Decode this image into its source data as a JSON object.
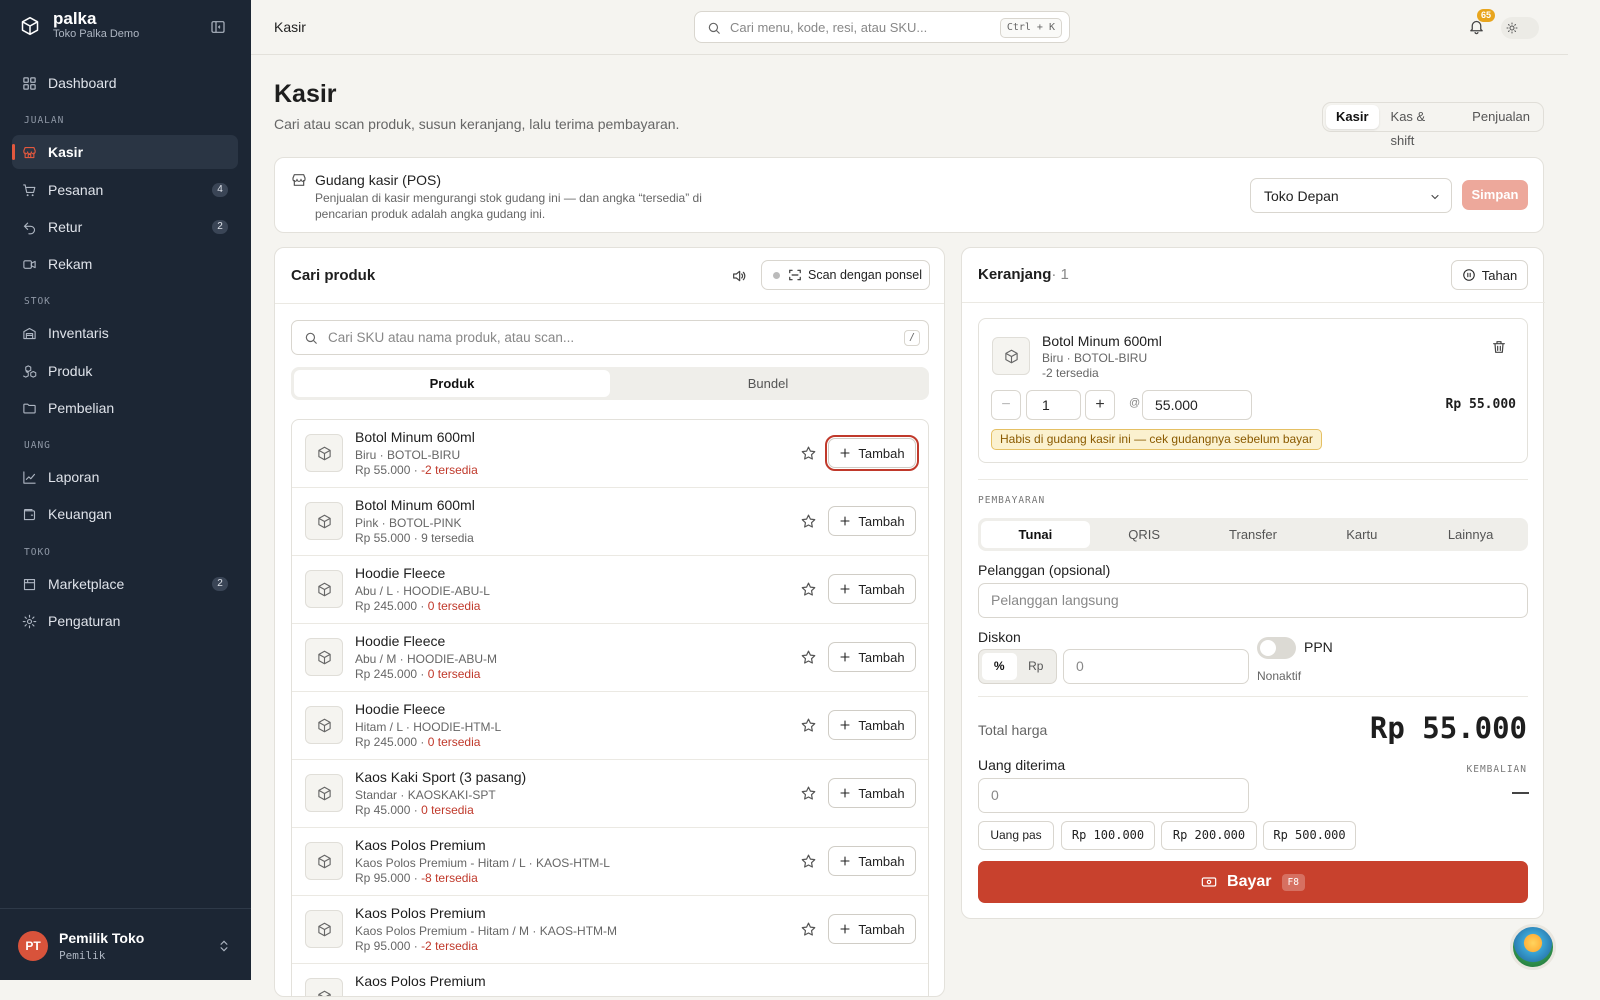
{
  "brand": {
    "name": "palka",
    "store": "Toko Palka Demo"
  },
  "nav": {
    "dashboard": "Dashboard",
    "sections": {
      "jualan": "JUALAN",
      "stok": "STOK",
      "uang": "UANG",
      "toko": "TOKO"
    },
    "items": [
      {
        "label": "Kasir"
      },
      {
        "label": "Pesanan",
        "badge": "4"
      },
      {
        "label": "Retur",
        "badge": "2"
      },
      {
        "label": "Rekam"
      },
      {
        "label": "Inventaris"
      },
      {
        "label": "Produk"
      },
      {
        "label": "Pembelian"
      },
      {
        "label": "Laporan"
      },
      {
        "label": "Keuangan"
      },
      {
        "label": "Marketplace",
        "badge": "2"
      },
      {
        "label": "Pengaturan"
      }
    ]
  },
  "user": {
    "initials": "PT",
    "name": "Pemilik Toko",
    "role": "Pemilik"
  },
  "topbar": {
    "breadcrumb": "Kasir",
    "search_placeholder": "Cari menu, kode, resi, atau SKU...",
    "search_shortcut": "Ctrl + K",
    "notifications": "65"
  },
  "page": {
    "title": "Kasir",
    "subtitle": "Cari atau scan produk, susun keranjang, lalu terima pembayaran.",
    "tabs": [
      "Kasir",
      "Kas & shift",
      "Penjualan"
    ]
  },
  "warehouse": {
    "title": "Gudang kasir (POS)",
    "description": "Penjualan di kasir mengurangi stok gudang ini — dan angka “tersedia” di pencarian produk adalah angka gudang ini.",
    "selected": "Toko Depan",
    "save": "Simpan"
  },
  "products": {
    "title": "Cari produk",
    "scan_label": "Scan dengan ponsel",
    "search_placeholder": "Cari SKU atau nama produk, atau scan...",
    "search_shortcut": "/",
    "tabs": [
      "Produk",
      "Bundel"
    ],
    "add_label": "Tambah",
    "items": [
      {
        "name": "Botol Minum 600ml",
        "variant": "Biru · BOTOL-BIRU",
        "price": "Rp 55.000",
        "stock": "-2 tersedia",
        "low": true
      },
      {
        "name": "Botol Minum 600ml",
        "variant": "Pink · BOTOL-PINK",
        "price": "Rp 55.000",
        "stock": "9 tersedia",
        "low": false
      },
      {
        "name": "Hoodie Fleece",
        "variant": "Abu / L · HOODIE-ABU-L",
        "price": "Rp 245.000",
        "stock": "0 tersedia",
        "low": true
      },
      {
        "name": "Hoodie Fleece",
        "variant": "Abu / M · HOODIE-ABU-M",
        "price": "Rp 245.000",
        "stock": "0 tersedia",
        "low": true
      },
      {
        "name": "Hoodie Fleece",
        "variant": "Hitam / L · HOODIE-HTM-L",
        "price": "Rp 245.000",
        "stock": "0 tersedia",
        "low": true
      },
      {
        "name": "Kaos Kaki Sport (3 pasang)",
        "variant": "Standar · KAOSKAKI-SPT",
        "price": "Rp 45.000",
        "stock": "0 tersedia",
        "low": true
      },
      {
        "name": "Kaos Polos Premium",
        "variant": "Kaos Polos Premium - Hitam / L · KAOS-HTM-L",
        "price": "Rp 95.000",
        "stock": "-8 tersedia",
        "low": true
      },
      {
        "name": "Kaos Polos Premium",
        "variant": "Kaos Polos Premium - Hitam / M · KAOS-HTM-M",
        "price": "Rp 95.000",
        "stock": "-2 tersedia",
        "low": true
      },
      {
        "name": "Kaos Polos Premium",
        "variant": "",
        "price": "",
        "stock": "",
        "low": false
      }
    ]
  },
  "cart": {
    "title": "Keranjang",
    "count": "· 1",
    "hold": "Tahan",
    "item": {
      "name": "Botol Minum 600ml",
      "variant": "Biru · BOTOL-BIRU",
      "stock": "-2 tersedia",
      "qty": "1",
      "unit_price": "55.000",
      "at": "@",
      "subtotal": "Rp 55.000",
      "warning": "Habis di gudang kasir ini — cek gudangnya sebelum bayar"
    },
    "payment_label": "PEMBAYARAN",
    "payment_methods": [
      "Tunai",
      "QRIS",
      "Transfer",
      "Kartu",
      "Lainnya"
    ],
    "customer_label": "Pelanggan (opsional)",
    "customer_placeholder": "Pelanggan langsung",
    "discount_label": "Diskon",
    "discount_types": [
      "%",
      "Rp"
    ],
    "discount_value": "0",
    "ppn_label": "PPN",
    "ppn_status": "Nonaktif",
    "total_label": "Total harga",
    "total_value": "Rp 55.000",
    "received_label": "Uang diterima",
    "received_value": "0",
    "change_label": "KEMBALIAN",
    "quick_amounts": [
      "Uang pas",
      "Rp 100.000",
      "Rp 200.000",
      "Rp 500.000"
    ],
    "pay_label": "Bayar",
    "pay_shortcut": "F8"
  },
  "colors": {
    "accent": "#c8412d",
    "sidebar": "#1c2634",
    "warning_bg": "#fbf1cf"
  }
}
